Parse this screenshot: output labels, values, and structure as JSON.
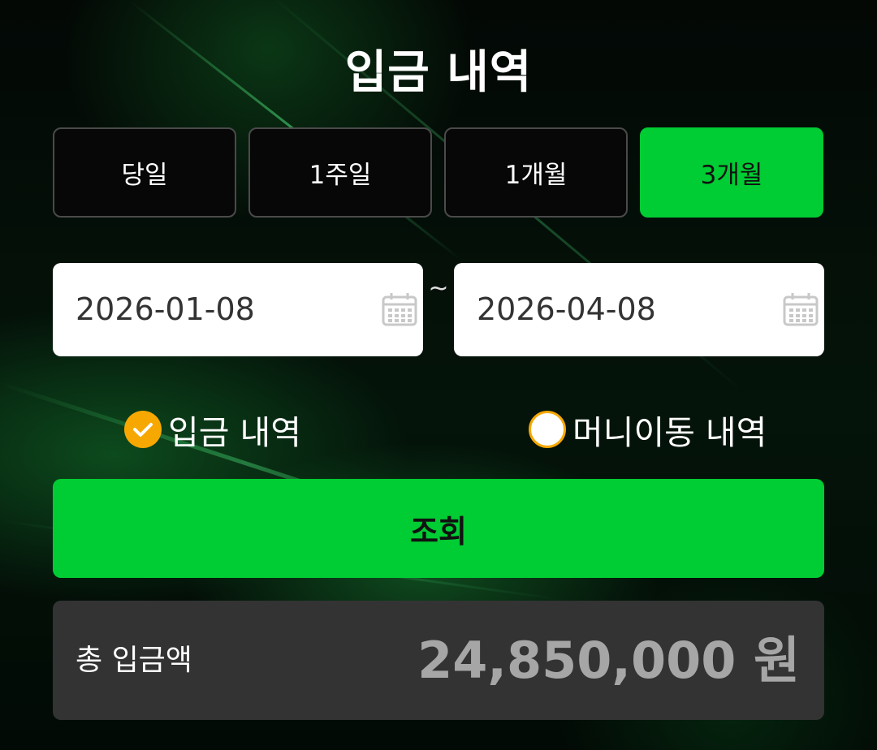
{
  "page": {
    "title": "입금 내역"
  },
  "period_filter": {
    "options": [
      {
        "label": "당일",
        "selected": false
      },
      {
        "label": "1주일",
        "selected": false
      },
      {
        "label": "1개월",
        "selected": false
      },
      {
        "label": "3개월",
        "selected": true
      }
    ]
  },
  "date_range": {
    "start": "2026-01-08",
    "separator": "~",
    "end": "2026-04-08",
    "start_icon": "calendar-icon",
    "end_icon": "calendar-icon"
  },
  "history_type": {
    "options": [
      {
        "label": "입금 내역",
        "checked": true
      },
      {
        "label": "머니이동 내역",
        "checked": false
      }
    ]
  },
  "search_button": {
    "label": "조회"
  },
  "summary": {
    "label": "총 입금액",
    "amount": "24,850,000 원"
  },
  "colors": {
    "accent_green": "#00cc33",
    "radio_orange": "#f6a800",
    "summary_bg": "#333333",
    "amount_text": "#a6a6a6"
  }
}
